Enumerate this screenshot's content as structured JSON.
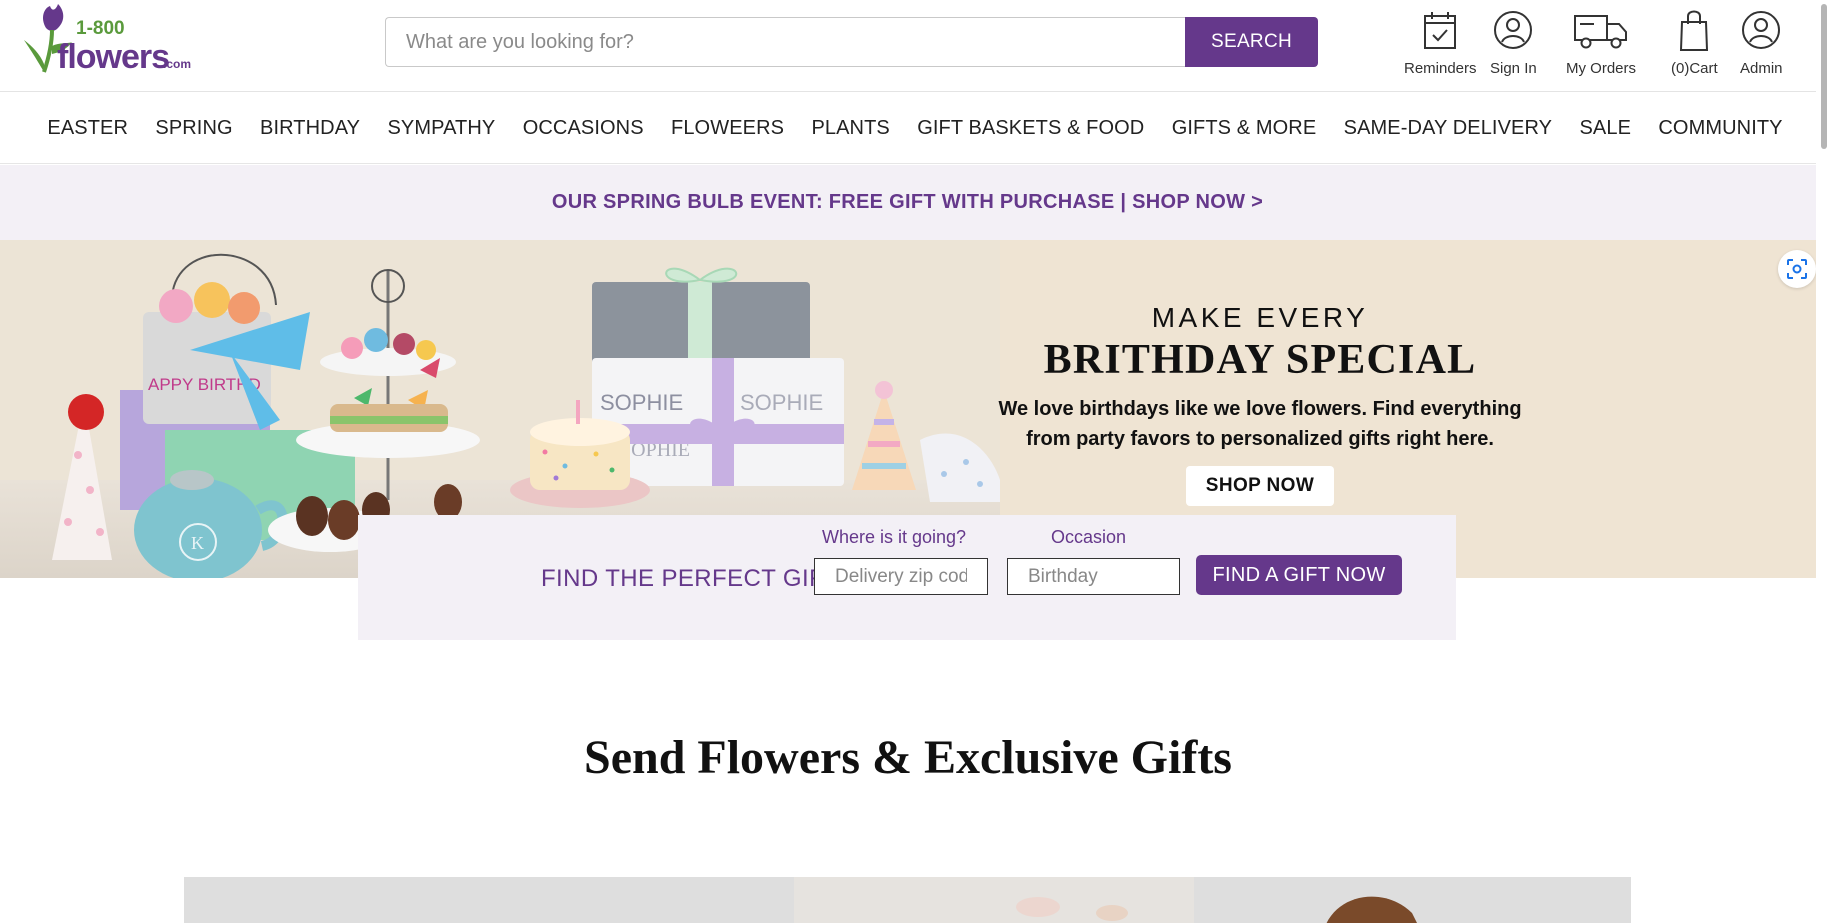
{
  "brand": {
    "logo_top": "1-800",
    "logo_main": "flowers",
    "logo_suffix": ".com",
    "accent_color": "#65388b",
    "leaf_color": "#5a9a3c"
  },
  "search": {
    "placeholder": "What are you looking for?",
    "button_label": "SEARCH"
  },
  "utility": [
    {
      "label": "Reminders",
      "icon": "calendar-check-icon"
    },
    {
      "label": "Sign In",
      "icon": "user-circle-icon"
    },
    {
      "label": "My Orders",
      "icon": "delivery-truck-icon"
    },
    {
      "label": "(0)Cart",
      "icon": "shopping-bag-icon"
    },
    {
      "label": "Admin",
      "icon": "user-circle-icon"
    }
  ],
  "nav": [
    "EASTER",
    "SPRING",
    "BIRTHDAY",
    "SYMPATHY",
    "OCCASIONS",
    "FLOWEERS",
    "PLANTS",
    "GIFT BASKETS & FOOD",
    "GIFTS & MORE",
    "SAME-DAY DELIVERY",
    "SALE",
    "COMMUNITY"
  ],
  "promo": {
    "text": "OUR SPRING BULB EVENT: FREE GIFT WITH PURCHASE | SHOP NOW >"
  },
  "hero": {
    "kicker": "MAKE EVERY",
    "title": "BRITHDAY SPECIAL",
    "copy_line1": "We love birthdays like we love flowers. Find everything",
    "copy_line2": "from party favors to personalized gifts right here.",
    "cta": "SHOP NOW",
    "background": "#efe4d3",
    "art_labels": {
      "banner": "APPY BIRTHD",
      "gift": "SOPHIE",
      "teapot": "K"
    }
  },
  "finder": {
    "title": "FIND THE PERFECT GIFT",
    "zip_label": "Where is it going?",
    "zip_placeholder": "Delivery zip code",
    "occasion_label": "Occasion",
    "occasion_value": "Birthday",
    "button_label": "FIND A GIFT NOW"
  },
  "section": {
    "title": "Send Flowers & Exclusive Gifts"
  }
}
